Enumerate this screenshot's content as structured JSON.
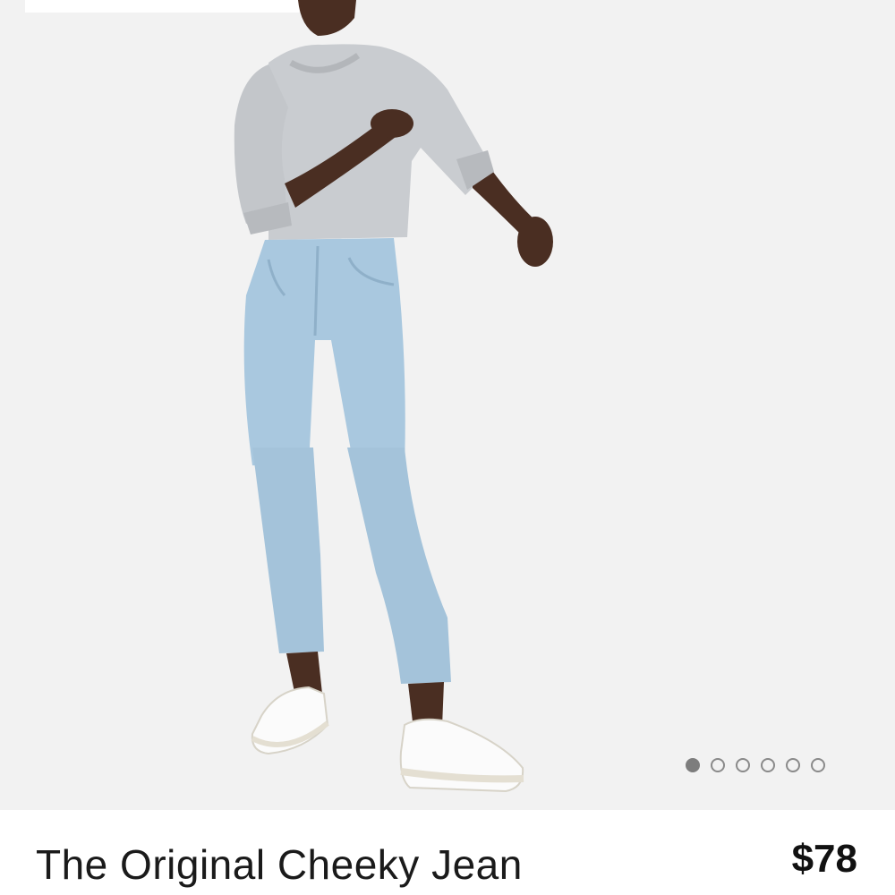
{
  "product": {
    "title": "The Original Cheeky Jean",
    "price": "$78"
  },
  "gallery": {
    "image": "model-wearing-light-wash-jeans-and-grey-sweatshirt",
    "image_count": 6,
    "active_index": 0
  },
  "colors": {
    "background": "#f2f2f2",
    "dot_active": "#7d7d7d",
    "dot_inactive": "#8a8a8a",
    "denim": "#a9c8df"
  }
}
